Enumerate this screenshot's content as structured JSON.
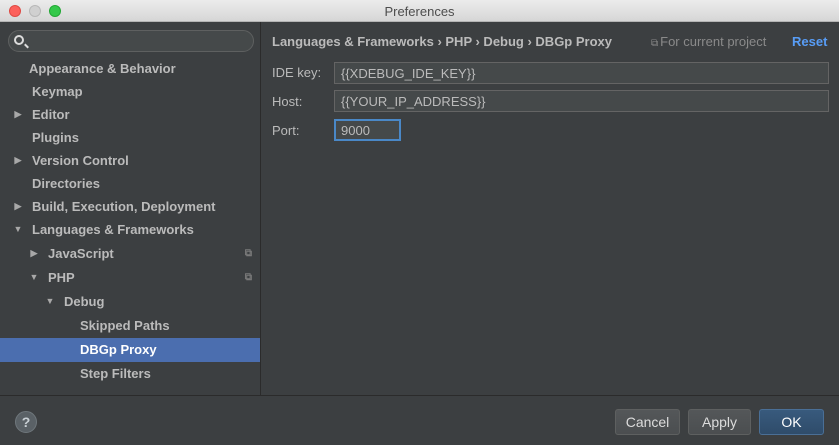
{
  "window": {
    "title": "Preferences"
  },
  "sidebar": {
    "items": [
      {
        "label": "Appearance & Behavior"
      },
      {
        "label": "Keymap"
      },
      {
        "label": "Editor"
      },
      {
        "label": "Plugins"
      },
      {
        "label": "Version Control"
      },
      {
        "label": "Directories"
      },
      {
        "label": "Build, Execution, Deployment"
      },
      {
        "label": "Languages & Frameworks"
      },
      {
        "label": "JavaScript"
      },
      {
        "label": "PHP"
      },
      {
        "label": "Debug"
      },
      {
        "label": "Skipped Paths"
      },
      {
        "label": "DBGp Proxy"
      },
      {
        "label": "Step Filters"
      }
    ]
  },
  "content": {
    "breadcrumb": "Languages & Frameworks › PHP › Debug › DBGp Proxy",
    "scope_label": "For current project",
    "reset_label": "Reset",
    "fields": {
      "ide_key": {
        "label": "IDE key:",
        "value": "{{XDEBUG_IDE_KEY}}"
      },
      "host": {
        "label": "Host:",
        "value": "{{YOUR_IP_ADDRESS}}"
      },
      "port": {
        "label": "Port:",
        "value": "9000"
      }
    }
  },
  "buttons": {
    "help": "?",
    "cancel": "Cancel",
    "apply": "Apply",
    "ok": "OK"
  },
  "icons": {
    "search": "search-icon",
    "expand": "chevron-right-icon",
    "collapse": "chevron-down-icon",
    "project_scope": "copy-icon"
  },
  "colors": {
    "accent": "#4b6eaf",
    "link": "#589df6",
    "focus": "#4a88c7"
  }
}
